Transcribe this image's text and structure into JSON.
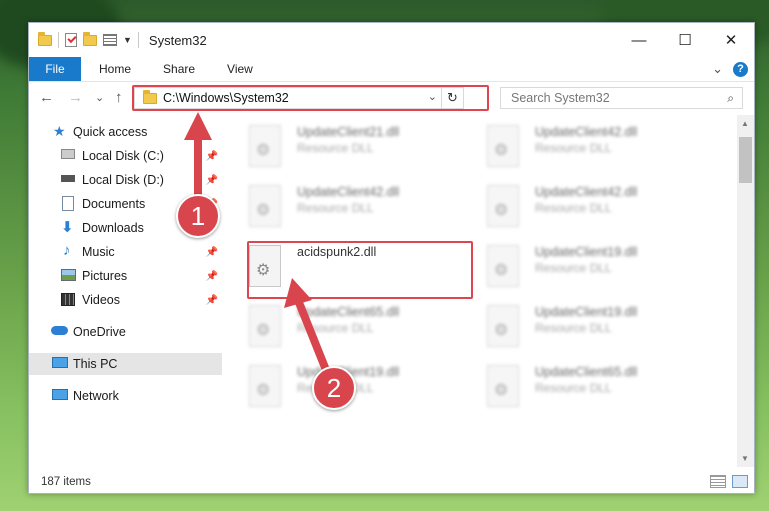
{
  "window": {
    "title": "System32",
    "controls": {
      "minimize": "—",
      "maximize": "☐",
      "close": "✕"
    }
  },
  "ribbon": {
    "tabs": [
      {
        "label": "File"
      },
      {
        "label": "Home"
      },
      {
        "label": "Share"
      },
      {
        "label": "View"
      }
    ],
    "collapse_glyph": "⌄",
    "help_glyph": "?"
  },
  "nav": {
    "back": "←",
    "forward": "→",
    "recent": "⌄",
    "up": "↑",
    "address": "C:\\Windows\\System32",
    "address_dropdown": "⌄",
    "refresh": "↻",
    "search_placeholder": "Search System32",
    "search_glyph": "⌕"
  },
  "sidebar": {
    "items": [
      {
        "label": "Quick access",
        "icon": "star-icon",
        "pinned": false
      },
      {
        "label": "Local Disk (C:)",
        "icon": "drive-icon",
        "pinned": true
      },
      {
        "label": "Local Disk (D:)",
        "icon": "drive-icon",
        "pinned": true
      },
      {
        "label": "Documents",
        "icon": "documents-icon",
        "pinned": true
      },
      {
        "label": "Downloads",
        "icon": "download-icon",
        "pinned": true
      },
      {
        "label": "Music",
        "icon": "music-icon",
        "pinned": true
      },
      {
        "label": "Pictures",
        "icon": "pictures-icon",
        "pinned": true
      },
      {
        "label": "Videos",
        "icon": "videos-icon",
        "pinned": true
      },
      {
        "label": "OneDrive",
        "icon": "cloud-icon",
        "pinned": false
      },
      {
        "label": "This PC",
        "icon": "computer-icon",
        "pinned": false,
        "selected": true
      },
      {
        "label": "Network",
        "icon": "network-icon",
        "pinned": false
      }
    ],
    "pin_glyph": "📌"
  },
  "files": [
    {
      "name": "UpdateClient21.dll",
      "desc": "Resource DLL",
      "blurred": true
    },
    {
      "name": "UpdateClient42.dll",
      "desc": "Resource DLL",
      "blurred": true
    },
    {
      "name": "UpdateClient42.dll",
      "desc": "Resource DLL",
      "blurred": true
    },
    {
      "name": "UpdateClient42.dll",
      "desc": "Resource DLL",
      "blurred": true
    },
    {
      "name": "acidspunk2.dll",
      "desc": "",
      "blurred": false
    },
    {
      "name": "UpdateClient19.dll",
      "desc": "Resource DLL",
      "blurred": true
    },
    {
      "name": "UpdateClient65.dll",
      "desc": "Resource DLL",
      "blurred": true
    },
    {
      "name": "UpdateClient19.dll",
      "desc": "Resource DLL",
      "blurred": true
    },
    {
      "name": "UpdateClient19.dll",
      "desc": "Resource DLL",
      "blurred": true
    },
    {
      "name": "UpdateClient65.dll",
      "desc": "Resource DLL",
      "blurred": true
    }
  ],
  "status": {
    "item_count": "187 items"
  },
  "callouts": [
    {
      "number": "1"
    },
    {
      "number": "2"
    }
  ],
  "colors": {
    "accent": "#1979ca",
    "highlight": "#e0444e",
    "callout": "#d9454d"
  }
}
